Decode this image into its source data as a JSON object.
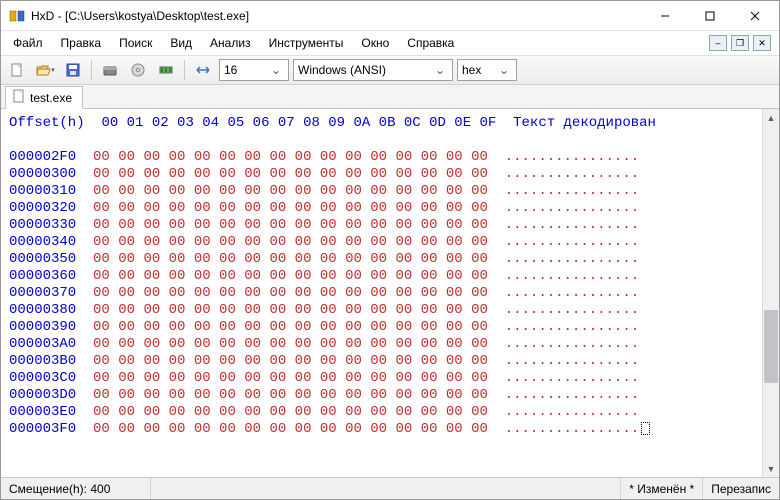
{
  "window": {
    "title": "HxD - [C:\\Users\\kostya\\Desktop\\test.exe]"
  },
  "menu": {
    "items": [
      "Файл",
      "Правка",
      "Поиск",
      "Вид",
      "Анализ",
      "Инструменты",
      "Окно",
      "Справка"
    ]
  },
  "toolbar": {
    "bytes_per_row": "16",
    "encoding": "Windows (ANSI)",
    "base": "hex"
  },
  "tab": {
    "label": "test.exe"
  },
  "hex": {
    "header_offset": "Offset(h)",
    "header_cols": "00 01 02 03 04 05 06 07 08 09 0A 0B 0C 0D 0E 0F",
    "header_text": "Текст декодирован",
    "rows": [
      {
        "offset": "000002F0",
        "bytes": "00 00 00 00 00 00 00 00 00 00 00 00 00 00 00 00",
        "text": "................"
      },
      {
        "offset": "00000300",
        "bytes": "00 00 00 00 00 00 00 00 00 00 00 00 00 00 00 00",
        "text": "................"
      },
      {
        "offset": "00000310",
        "bytes": "00 00 00 00 00 00 00 00 00 00 00 00 00 00 00 00",
        "text": "................"
      },
      {
        "offset": "00000320",
        "bytes": "00 00 00 00 00 00 00 00 00 00 00 00 00 00 00 00",
        "text": "................"
      },
      {
        "offset": "00000330",
        "bytes": "00 00 00 00 00 00 00 00 00 00 00 00 00 00 00 00",
        "text": "................"
      },
      {
        "offset": "00000340",
        "bytes": "00 00 00 00 00 00 00 00 00 00 00 00 00 00 00 00",
        "text": "................"
      },
      {
        "offset": "00000350",
        "bytes": "00 00 00 00 00 00 00 00 00 00 00 00 00 00 00 00",
        "text": "................"
      },
      {
        "offset": "00000360",
        "bytes": "00 00 00 00 00 00 00 00 00 00 00 00 00 00 00 00",
        "text": "................"
      },
      {
        "offset": "00000370",
        "bytes": "00 00 00 00 00 00 00 00 00 00 00 00 00 00 00 00",
        "text": "................"
      },
      {
        "offset": "00000380",
        "bytes": "00 00 00 00 00 00 00 00 00 00 00 00 00 00 00 00",
        "text": "................"
      },
      {
        "offset": "00000390",
        "bytes": "00 00 00 00 00 00 00 00 00 00 00 00 00 00 00 00",
        "text": "................"
      },
      {
        "offset": "000003A0",
        "bytes": "00 00 00 00 00 00 00 00 00 00 00 00 00 00 00 00",
        "text": "................"
      },
      {
        "offset": "000003B0",
        "bytes": "00 00 00 00 00 00 00 00 00 00 00 00 00 00 00 00",
        "text": "................"
      },
      {
        "offset": "000003C0",
        "bytes": "00 00 00 00 00 00 00 00 00 00 00 00 00 00 00 00",
        "text": "................"
      },
      {
        "offset": "000003D0",
        "bytes": "00 00 00 00 00 00 00 00 00 00 00 00 00 00 00 00",
        "text": "................"
      },
      {
        "offset": "000003E0",
        "bytes": "00 00 00 00 00 00 00 00 00 00 00 00 00 00 00 00",
        "text": "................"
      },
      {
        "offset": "000003F0",
        "bytes": "00 00 00 00 00 00 00 00 00 00 00 00 00 00 00 00",
        "text": "................",
        "caret": true
      }
    ]
  },
  "status": {
    "offset": "Смещение(h): 400",
    "modified": "* Изменён *",
    "overwrite": "Перезапис"
  },
  "colors": {
    "accent_blue": "#0000d0",
    "hex_red": "#c03030"
  }
}
